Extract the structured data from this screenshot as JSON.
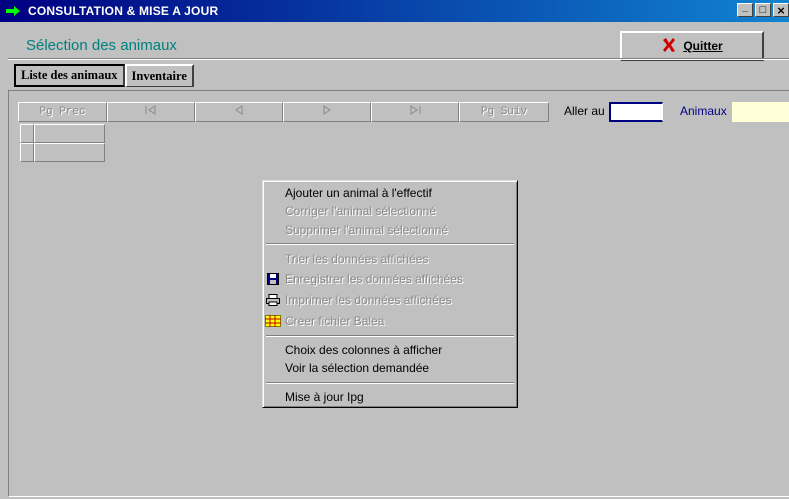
{
  "window": {
    "title": "CONSULTATION & MISE A JOUR",
    "controls": {
      "minimize": "_",
      "maximize": "□",
      "close": "×"
    }
  },
  "header": {
    "page_title": "Sélection des animaux",
    "quit_label": "Quitter"
  },
  "tabs": [
    {
      "label": "Liste des animaux",
      "active": true
    },
    {
      "label": "Inventaire",
      "active": false
    }
  ],
  "navbar": {
    "prev_page": "Pg Prec",
    "first": "|◁",
    "prev": "◁",
    "next": "▷",
    "last": "▷|",
    "next_page": "Pg Suiv",
    "goto_label": "Aller au",
    "goto_value": "",
    "animals_label": "Animaux",
    "animals_value": ""
  },
  "context_menu": {
    "items": [
      {
        "label": "Ajouter un animal à l'effectif",
        "enabled": true,
        "icon": ""
      },
      {
        "label": "Corriger l'animal sélectionné",
        "enabled": false,
        "icon": ""
      },
      {
        "label": "Supprimer l'animal sélectionné",
        "enabled": false,
        "icon": ""
      },
      {
        "label": "Trier les données affichées",
        "enabled": false,
        "icon": ""
      },
      {
        "label": "Enregistrer les données affichées",
        "enabled": false,
        "icon": "floppy-disk-icon"
      },
      {
        "label": "Imprimer les données affichées",
        "enabled": false,
        "icon": "printer-icon"
      },
      {
        "label": "Creer  fichier Balea",
        "enabled": false,
        "icon": "spreadsheet-icon"
      },
      {
        "label": "Choix des colonnes à afficher",
        "enabled": true,
        "icon": ""
      },
      {
        "label": "Voir la sélection demandée",
        "enabled": true,
        "icon": ""
      },
      {
        "label": "Mise à jour Ipg",
        "enabled": true,
        "icon": ""
      }
    ]
  },
  "colors": {
    "title_bar_start": "#000080",
    "title_bar_end": "#1084d0",
    "page_title": "#008080",
    "surface": "#c0c0c0",
    "disabled_text": "#8a8a8a",
    "animals_field_bg": "#ffffd8",
    "quit_icon": "#cc0000"
  }
}
